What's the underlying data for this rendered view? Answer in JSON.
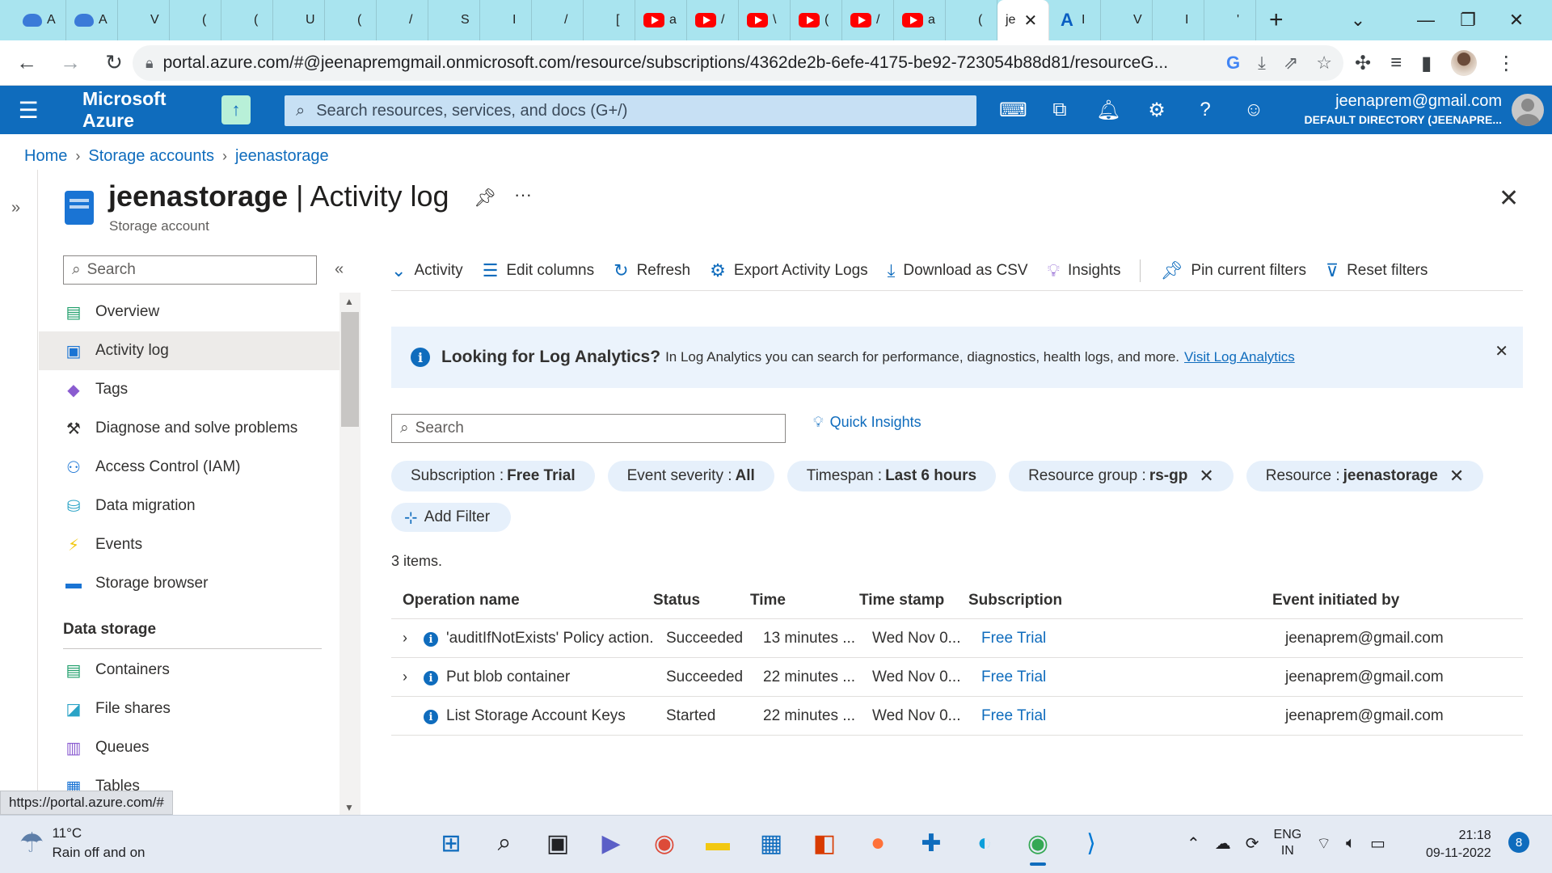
{
  "browser": {
    "tabs": [
      {
        "icon": "azure-cloud-icon",
        "label": "A"
      },
      {
        "icon": "azure-cloud-icon",
        "label": "A"
      },
      {
        "icon": "microsoft-icon",
        "label": "V"
      },
      {
        "icon": "microsoft-icon",
        "label": "("
      },
      {
        "icon": "microsoft-icon",
        "label": "("
      },
      {
        "icon": "microsoft-icon",
        "label": "U"
      },
      {
        "icon": "microsoft-icon",
        "label": "("
      },
      {
        "icon": "microsoft-icon",
        "label": "/"
      },
      {
        "icon": "microsoft-icon",
        "label": "S"
      },
      {
        "icon": "microsoft-icon",
        "label": "I"
      },
      {
        "icon": "microsoft-icon",
        "label": "/"
      },
      {
        "icon": "microsoft-icon",
        "label": "["
      },
      {
        "icon": "youtube-icon",
        "label": "a"
      },
      {
        "icon": "youtube-icon",
        "label": "/"
      },
      {
        "icon": "youtube-icon",
        "label": "\\"
      },
      {
        "icon": "youtube-icon",
        "label": "("
      },
      {
        "icon": "youtube-icon",
        "label": "/"
      },
      {
        "icon": "youtube-icon",
        "label": "a"
      },
      {
        "icon": "microsoft-icon",
        "label": "("
      }
    ],
    "active_tab_label": "je",
    "tabs_after": [
      {
        "icon": "azure-a-icon",
        "label": "I"
      },
      {
        "icon": "microsoft-icon",
        "label": "V"
      },
      {
        "icon": "microsoft-icon",
        "label": "I"
      },
      {
        "icon": "microsoft-icon",
        "label": "'"
      }
    ],
    "url": "portal.azure.com/#@jeenapremgmail.onmicrosoft.com/resource/subscriptions/4362de2b-6efe-4175-be92-723054b88d81/resourceG...",
    "status_url": "https://portal.azure.com/#"
  },
  "azure": {
    "brand": "Microsoft Azure",
    "search_placeholder": "Search resources, services, and docs (G+/)",
    "account_email": "jeenaprem@gmail.com",
    "account_directory": "DEFAULT DIRECTORY (JEENAPRE..."
  },
  "breadcrumb": [
    "Home",
    "Storage accounts",
    "jeenastorage"
  ],
  "blade": {
    "resource_name": "jeenastorage",
    "separator": "|",
    "page_name": "Activity log",
    "subtitle": "Storage account"
  },
  "menu": {
    "search_placeholder": "Search",
    "items": [
      {
        "label": "Overview",
        "icon": "overview-icon",
        "color": "#1e9e6a"
      },
      {
        "label": "Activity log",
        "icon": "activity-log-icon",
        "color": "#1a74d4",
        "active": true
      },
      {
        "label": "Tags",
        "icon": "tag-icon",
        "color": "#8a5cd0"
      },
      {
        "label": "Diagnose and solve problems",
        "icon": "wrench-icon",
        "color": "#323130"
      },
      {
        "label": "Access Control (IAM)",
        "icon": "people-icon",
        "color": "#1a74d4"
      },
      {
        "label": "Data migration",
        "icon": "data-migration-icon",
        "color": "#2aa3c6"
      },
      {
        "label": "Events",
        "icon": "lightning-icon",
        "color": "#f2c811"
      },
      {
        "label": "Storage browser",
        "icon": "storage-browser-icon",
        "color": "#1a74d4"
      }
    ],
    "section": "Data storage",
    "section_items": [
      {
        "label": "Containers",
        "icon": "containers-icon",
        "color": "#1e9e6a"
      },
      {
        "label": "File shares",
        "icon": "file-shares-icon",
        "color": "#2aa3c6"
      },
      {
        "label": "Queues",
        "icon": "queues-icon",
        "color": "#8a5cd0"
      },
      {
        "label": "Tables",
        "icon": "tables-icon",
        "color": "#1a74d4"
      }
    ]
  },
  "commands": [
    {
      "label": "Activity",
      "icon": "chevron-down-icon"
    },
    {
      "label": "Edit columns",
      "icon": "columns-icon"
    },
    {
      "label": "Refresh",
      "icon": "refresh-icon"
    },
    {
      "label": "Export Activity Logs",
      "icon": "gear-icon"
    },
    {
      "label": "Download as CSV",
      "icon": "download-icon"
    },
    {
      "label": "Insights",
      "icon": "lightbulb-icon"
    },
    {
      "label": "Pin current filters",
      "icon": "pin-icon"
    },
    {
      "label": "Reset filters",
      "icon": "filter-reset-icon"
    }
  ],
  "banner": {
    "title": "Looking for Log Analytics?",
    "text": "In Log Analytics you can search for performance, diagnostics, health logs, and more.",
    "link": "Visit Log Analytics"
  },
  "filters": {
    "search_placeholder": "Search",
    "quick_insights": "Quick Insights",
    "pills": [
      {
        "key": "Subscription :",
        "value": "Free Trial",
        "removable": false
      },
      {
        "key": "Event severity :",
        "value": "All",
        "removable": false
      },
      {
        "key": "Timespan :",
        "value": "Last 6 hours",
        "removable": false
      },
      {
        "key": "Resource group :",
        "value": "rs-gp",
        "removable": true
      },
      {
        "key": "Resource :",
        "value": "jeenastorage",
        "removable": true
      }
    ],
    "add_filter": "Add Filter"
  },
  "table": {
    "count": "3 items.",
    "headers": [
      "Operation name",
      "Status",
      "Time",
      "Time stamp",
      "Subscription",
      "Event initiated by"
    ],
    "rows": [
      {
        "expand": true,
        "operation": "'auditIfNotExists' Policy action.",
        "status": "Succeeded",
        "time": "13 minutes ...",
        "timestamp": "Wed Nov 0...",
        "subscription": "Free Trial",
        "initiated_by": "jeenaprem@gmail.com"
      },
      {
        "expand": true,
        "operation": "Put blob container",
        "status": "Succeeded",
        "time": "22 minutes ...",
        "timestamp": "Wed Nov 0...",
        "subscription": "Free Trial",
        "initiated_by": "jeenaprem@gmail.com"
      },
      {
        "expand": false,
        "operation": "List Storage Account Keys",
        "status": "Started",
        "time": "22 minutes ...",
        "timestamp": "Wed Nov 0...",
        "subscription": "Free Trial",
        "initiated_by": "jeenaprem@gmail.com"
      }
    ]
  },
  "taskbar": {
    "temperature": "11°C",
    "weather": "Rain off and on",
    "lang_1": "ENG",
    "lang_2": "IN",
    "time": "21:18",
    "date": "09-11-2022",
    "notifications": "8"
  }
}
